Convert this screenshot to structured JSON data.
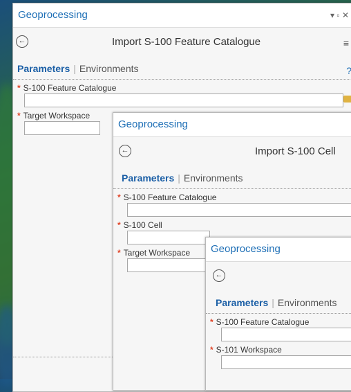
{
  "window1": {
    "title": "Geoprocessing",
    "tool_title": "Import S-100 Feature Catalogue",
    "tab_parameters": "Parameters",
    "tab_separator": "|",
    "tab_environments": "Environments",
    "params": [
      {
        "label": "S-100 Feature Catalogue"
      },
      {
        "label": "Target Workspace"
      }
    ]
  },
  "window2": {
    "title": "Geoprocessing",
    "tool_title": "Import S-100 Cell",
    "tab_parameters": "Parameters",
    "tab_separator": "|",
    "tab_environments": "Environments",
    "params": [
      {
        "label": "S-100 Feature Catalogue"
      },
      {
        "label": "S-100 Cell"
      },
      {
        "label": "Target Workspace"
      }
    ]
  },
  "window3": {
    "title": "Geoprocessing",
    "tab_parameters": "Parameters",
    "tab_separator": "|",
    "tab_environments": "Environments",
    "params": [
      {
        "label": "S-100 Feature Catalogue"
      },
      {
        "label": "S-101 Workspace"
      }
    ]
  },
  "icons": {
    "back": "back-arrow-circle-icon",
    "menu": "hamburger-menu-icon",
    "help": "help-icon",
    "folder": "folder-icon",
    "window_controls": "window-controls-icon"
  },
  "colors": {
    "title_blue": "#1e6fb6",
    "tab_active": "#1b5fa6",
    "required_star": "#e0462a"
  }
}
